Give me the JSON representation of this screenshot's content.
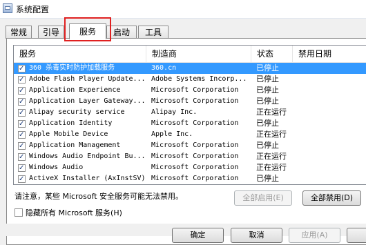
{
  "window": {
    "title": "系统配置"
  },
  "tabs": [
    {
      "label": "常规"
    },
    {
      "label": "引导"
    },
    {
      "label": "服务"
    },
    {
      "label": "启动"
    },
    {
      "label": "工具"
    }
  ],
  "columns": {
    "service": "服务",
    "manufacturer": "制造商",
    "status": "状态",
    "disabled_date": "禁用日期"
  },
  "services": [
    {
      "name": "360 杀毒实时防护加载服务",
      "manufacturer": "360.cn",
      "status": "已停止",
      "checked": true,
      "selected": true
    },
    {
      "name": "Adobe Flash Player Update...",
      "manufacturer": "Adobe Systems Incorp...",
      "status": "已停止",
      "checked": true
    },
    {
      "name": "Application Experience",
      "manufacturer": "Microsoft Corporation",
      "status": "已停止",
      "checked": true
    },
    {
      "name": "Application Layer Gateway...",
      "manufacturer": "Microsoft Corporation",
      "status": "已停止",
      "checked": true
    },
    {
      "name": "Alipay security service",
      "manufacturer": "Alipay Inc.",
      "status": "正在运行",
      "checked": true
    },
    {
      "name": "Application Identity",
      "manufacturer": "Microsoft Corporation",
      "status": "已停止",
      "checked": true
    },
    {
      "name": "Apple Mobile Device",
      "manufacturer": "Apple Inc.",
      "status": "正在运行",
      "checked": true
    },
    {
      "name": "Application Management",
      "manufacturer": "Microsoft Corporation",
      "status": "已停止",
      "checked": true
    },
    {
      "name": "Windows Audio Endpoint Bu...",
      "manufacturer": "Microsoft Corporation",
      "status": "正在运行",
      "checked": true
    },
    {
      "name": "Windows Audio",
      "manufacturer": "Microsoft Corporation",
      "status": "正在运行",
      "checked": true
    },
    {
      "name": "ActiveX Installer (AxInstSV)",
      "manufacturer": "Microsoft Corporation",
      "status": "已停止",
      "checked": true
    }
  ],
  "note": "请注意，某些 Microsoft 安全服务可能无法禁用。",
  "buttons": {
    "enable_all": "全部启用(E)",
    "disable_all": "全部禁用(D)",
    "ok": "确定",
    "cancel": "取消",
    "apply": "应用(A)"
  },
  "hide_ms": {
    "label": "隐藏所有 Microsoft 服务(H)",
    "checked": false
  },
  "colors": {
    "selection": "#3399ff",
    "highlight_box": "#e02020"
  }
}
